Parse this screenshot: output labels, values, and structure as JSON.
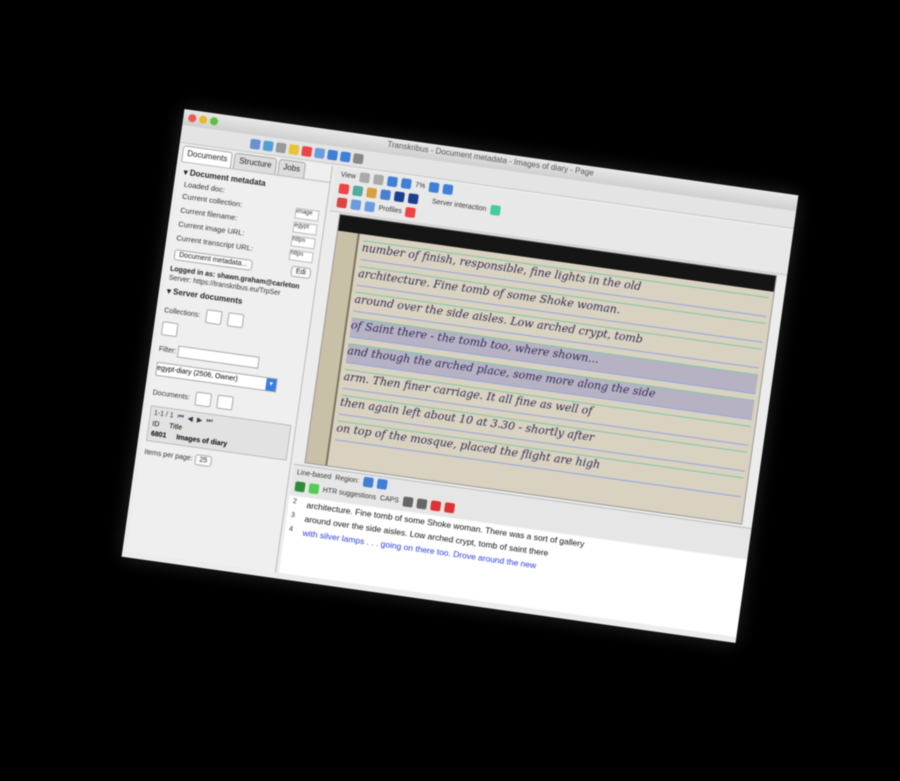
{
  "window": {
    "title": "Transkribus - Document metadata - Images of diary - Page"
  },
  "left_panel": {
    "tabs": [
      "Documents",
      "Structure",
      "Jobs"
    ],
    "metadata_heading": "Document metadata",
    "rows": [
      {
        "label": "Loaded doc:",
        "value": ""
      },
      {
        "label": "Current collection:",
        "value": "image"
      },
      {
        "label": "Current filename:",
        "value": "egypt"
      },
      {
        "label": "Current image URL:",
        "value": "https"
      },
      {
        "label": "Current transcript URL:",
        "value": "https"
      }
    ],
    "metadata_button": "Document metadata...",
    "edit_button": "Edi",
    "logged_in": "Logged in as: shawn.graham@carleton",
    "server": "Server: https://transkribus.eu/TrpSer",
    "server_docs_heading": "Server documents",
    "collections_label": "Collections:",
    "filter_label": "Filter:",
    "collection_select": "egypt-diary (2506, Owner)",
    "documents_label": "Documents:",
    "doc_nav": "1-1 / 1",
    "doc_headers": [
      "ID",
      "Title"
    ],
    "doc_row": {
      "id": "6801",
      "title": "Images of diary"
    },
    "items_per_page_label": "Items per page:",
    "items_per_page": "25"
  },
  "main": {
    "view_label": "View",
    "zoom": "7%",
    "server_interaction": "Server interaction",
    "profiles": "Profiles",
    "lines": [
      "number of finish, responsible, fine lights in the old",
      "architecture. Fine tomb of some Shoke woman.",
      "around over the side aisles. Low arched crypt, tomb",
      "of Saint there - the tomb too, where shown...",
      "and though the arched place, some more along the side",
      "arm. Then finer carriage. It all fine as well of",
      "then again left about 10 at 3.30 - shortly after",
      "on top of the mosque, placed the flight are high"
    ],
    "editor_mode": "Line-based",
    "region_label": "Region:",
    "suggestions": "HTR suggestions",
    "caps_label": "CAPS",
    "text_lines": [
      {
        "n": "2",
        "text": "architecture. Fine tomb of some Shoke woman. There was a sort of gallery",
        "blue": false
      },
      {
        "n": "3",
        "text": "around over the side aisles. Low arched crypt, tomb of saint there",
        "blue": false
      },
      {
        "n": "4",
        "text": "with silver lamps . . . going on there too. Drove around the new",
        "blue": true
      }
    ]
  },
  "colors": {
    "accent": "#3a7de0",
    "baseline_green": "#7cc6a6",
    "ink": "#2e2b55",
    "selected_line_blue": "#2a3de0"
  }
}
